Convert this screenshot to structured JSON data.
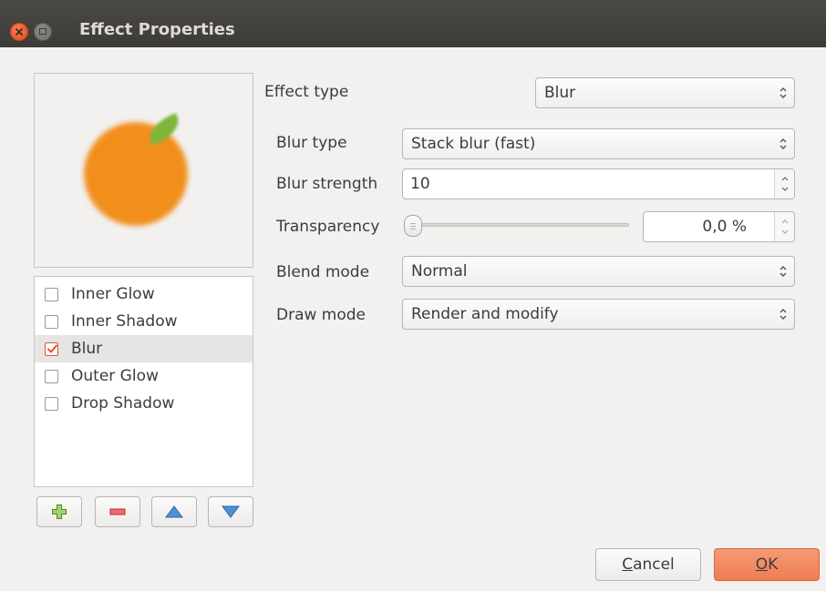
{
  "window": {
    "title": "Effect Properties"
  },
  "effects": [
    {
      "label": "Inner Glow",
      "checked": false,
      "selected": false
    },
    {
      "label": "Inner Shadow",
      "checked": false,
      "selected": false
    },
    {
      "label": "Blur",
      "checked": true,
      "selected": true
    },
    {
      "label": "Outer Glow",
      "checked": false,
      "selected": false
    },
    {
      "label": "Drop Shadow",
      "checked": false,
      "selected": false
    }
  ],
  "form": {
    "effect_type_label": "Effect type",
    "effect_type_value": "Blur",
    "blur_type_label": "Blur type",
    "blur_type_value": "Stack blur (fast)",
    "blur_strength_label": "Blur strength",
    "blur_strength_value": "10",
    "transparency_label": "Transparency",
    "transparency_value": "0,0 %",
    "transparency_fraction": 0.0,
    "blend_mode_label": "Blend mode",
    "blend_mode_value": "Normal",
    "draw_mode_label": "Draw mode",
    "draw_mode_value": "Render and modify"
  },
  "buttons": {
    "cancel_mnemonic": "C",
    "cancel_rest": "ancel",
    "ok_mnemonic": "O",
    "ok_rest": "K"
  },
  "colors": {
    "accent": "#ef7d52",
    "titlebar": "#3c3b37",
    "close": "#df4a16"
  }
}
